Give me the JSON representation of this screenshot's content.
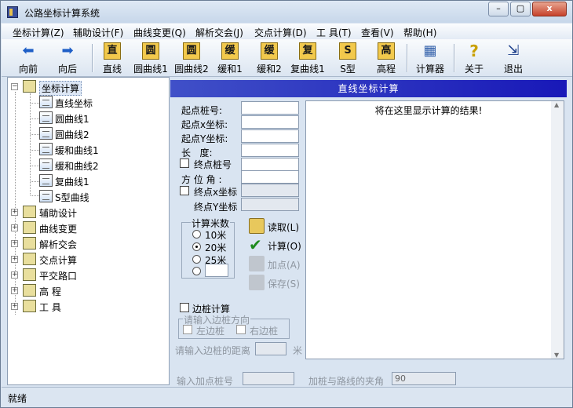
{
  "window": {
    "title": "公路坐标计算系统",
    "buttons": [
      "–",
      "▢",
      "x"
    ]
  },
  "menu": [
    "坐标计算(Z)",
    "辅助设计(F)",
    "曲线变更(Q)",
    "解析交会(J)",
    "交点计算(D)",
    "工 具(T)",
    "查看(V)",
    "帮助(H)"
  ],
  "toolbar": [
    {
      "label": "向前",
      "glyph": "⬅"
    },
    {
      "label": "向后",
      "glyph": "➡"
    },
    {
      "label": "直线",
      "glyph": "直"
    },
    {
      "label": "圆曲线1",
      "glyph": "圆"
    },
    {
      "label": "圆曲线2",
      "glyph": "圆"
    },
    {
      "label": "缓和1",
      "glyph": "缓"
    },
    {
      "label": "缓和2",
      "glyph": "缓"
    },
    {
      "label": "复曲线1",
      "glyph": "复"
    },
    {
      "label": "S型",
      "glyph": "S"
    },
    {
      "label": "高程",
      "glyph": "高"
    },
    {
      "label": "计算器",
      "glyph": "▦"
    },
    {
      "label": "关于",
      "glyph": "?"
    },
    {
      "label": "退出",
      "glyph": "⇲"
    }
  ],
  "tree": {
    "root": "坐标计算",
    "children": [
      "直线坐标",
      "圆曲线1",
      "圆曲线2",
      "缓和曲线1",
      "缓和曲线2",
      "复曲线1",
      "S型曲线"
    ],
    "others": [
      "辅助设计",
      "曲线变更",
      "解析交会",
      "交点计算",
      "平交路口",
      "高 程",
      "工 具"
    ]
  },
  "panel": {
    "title": "直线坐标计算",
    "labels": {
      "start_station": "起点桩号:",
      "start_x": "起点x坐标:",
      "start_y": "起点Y坐标:",
      "length": "长   度:",
      "end_station": "终点桩号",
      "azimuth": "方 位 角 :",
      "end_x": "终点x坐标",
      "end_y": "终点Y坐标"
    },
    "step_group": {
      "title": "计算米数",
      "options": [
        "10米",
        "20米",
        "25米"
      ],
      "selected": "20米"
    },
    "actions": {
      "read": "读取(L)",
      "calc": "计算(O)",
      "add": "加点(A)",
      "save": "保存(S)"
    },
    "result_placeholder": "将在这里显示计算的结果!",
    "side_stake": {
      "checkbox": "边桩计算",
      "direction_group": "请输入边桩方向",
      "left": "左边桩",
      "right": "右边桩",
      "distance_label": "请输入边桩的距离",
      "distance_unit": "米"
    },
    "add_point": {
      "label": "输入加点桩号",
      "angle_label": "加桩与路线的夹角",
      "angle_value": "90"
    }
  },
  "status": {
    "text": "就绪"
  }
}
